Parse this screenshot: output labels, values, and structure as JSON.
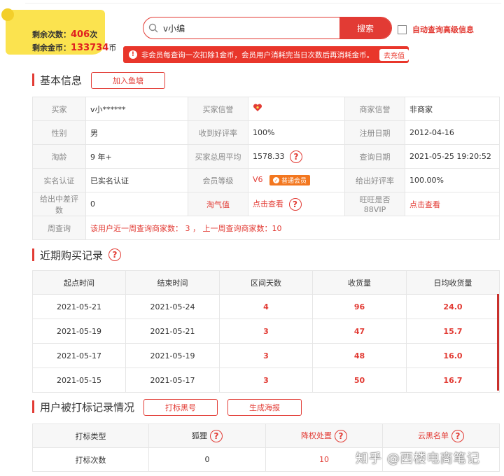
{
  "quota": {
    "remaining_count_label": "剩余次数：",
    "remaining_count": "406",
    "remaining_count_unit": "次",
    "remaining_coins_label": "剩余金币：",
    "remaining_coins": "133734",
    "remaining_coins_unit": "币"
  },
  "search": {
    "value": "v小编",
    "button": "搜索",
    "auto_query_label": "自动查询高级信息"
  },
  "notice": {
    "text": "非会员每查询一次扣除1金币，会员用户消耗完当日次数后再消耗金币。",
    "charge_button": "去充值"
  },
  "basic": {
    "title": "基本信息",
    "add_button": "加入鱼塘",
    "rows": [
      [
        {
          "l": "买家",
          "v": "v小******"
        },
        {
          "l": "买家信誉",
          "v": ""
        },
        {
          "l": "商家信誉",
          "v": "非商家"
        }
      ],
      [
        {
          "l": "性别",
          "v": "男"
        },
        {
          "l": "收到好评率",
          "v": "100%"
        },
        {
          "l": "注册日期",
          "v": "2012-04-16"
        }
      ],
      [
        {
          "l": "淘龄",
          "v": "9 年+"
        },
        {
          "l": "买家总周平均",
          "v": "1578.33"
        },
        {
          "l": "查询日期",
          "v": "2021-05-25 19:20:52"
        }
      ],
      [
        {
          "l": "实名认证",
          "v": "已实名认证"
        },
        {
          "l": "会员等级",
          "v": "V6"
        },
        {
          "l": "给出好评率",
          "v": "100.00%"
        }
      ],
      [
        {
          "l": "给出中差评数",
          "v": "0"
        },
        {
          "l": "淘气值",
          "v": "点击查看"
        },
        {
          "l": "旺旺是否88VIP",
          "v": "点击查看"
        }
      ]
    ],
    "member_badge": "普通会员",
    "weekly_label": "周查询",
    "weekly_text": "该用户近一周查询商家数： 3 ， 上一周查询商家数：10"
  },
  "purchase": {
    "title": "近期购买记录",
    "headers": [
      "起点时间",
      "结束时间",
      "区间天数",
      "收货量",
      "日均收货量"
    ],
    "rows": [
      [
        "2021-05-21",
        "2021-05-24",
        "4",
        "96",
        "24.0"
      ],
      [
        "2021-05-19",
        "2021-05-21",
        "3",
        "47",
        "15.7"
      ],
      [
        "2021-05-17",
        "2021-05-19",
        "3",
        "48",
        "16.0"
      ],
      [
        "2021-05-15",
        "2021-05-17",
        "3",
        "50",
        "16.7"
      ]
    ]
  },
  "mark": {
    "title": "用户被打标记录情况",
    "btn1": "打标黑号",
    "btn2": "生成海报",
    "headers": [
      "打标类型",
      "狐狸",
      "降权处置",
      "云黑名单"
    ],
    "row": [
      "打标次数",
      "0",
      "10",
      ""
    ]
  },
  "watermark": "知乎 @西楼电商笔记",
  "colors": {
    "accent": "#e23b34",
    "quota_yellow": "#fbe34f"
  }
}
